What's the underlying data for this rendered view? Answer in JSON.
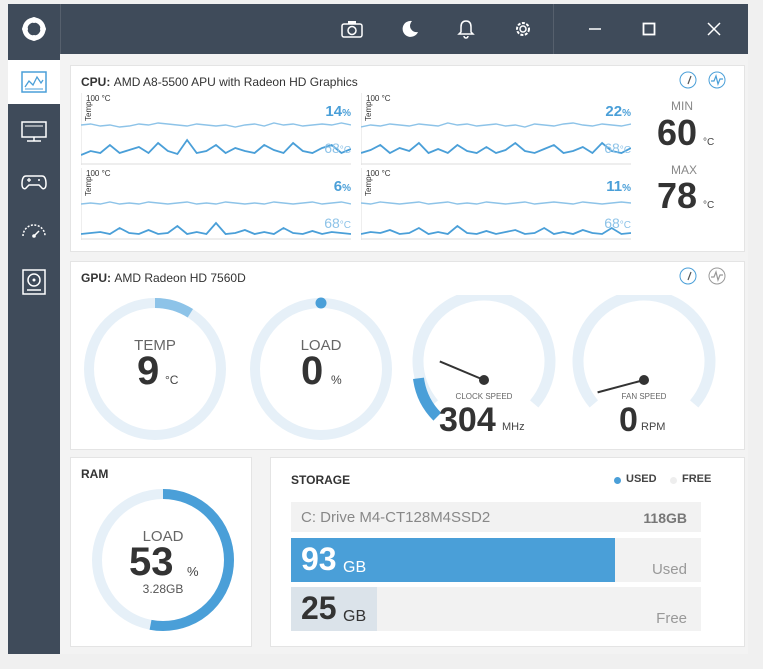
{
  "titlebar": {
    "camera_icon": "camera-icon",
    "moon_icon": "moon-icon",
    "bell_icon": "bell-icon",
    "gear_icon": "gear-icon",
    "min_icon": "minimize-icon",
    "max_icon": "maximize-icon",
    "close_icon": "close-icon"
  },
  "sidebar": {
    "items": [
      "dashboard-icon",
      "monitor-icon",
      "gamepad-icon",
      "gauge-icon",
      "hdd-icon"
    ]
  },
  "cpu": {
    "label": "CPU:",
    "name": "AMD A8-5500 APU with Radeon HD Graphics",
    "graphs": [
      {
        "top_label": "100 °C",
        "axis_label": "Temp",
        "load": "14",
        "temp": "68"
      },
      {
        "top_label": "100 °C",
        "axis_label": "Temp",
        "load": "22",
        "temp": "68"
      },
      {
        "top_label": "100 °C",
        "axis_label": "Temp",
        "load": "6",
        "temp": "68"
      },
      {
        "top_label": "100 °C",
        "axis_label": "Temp",
        "load": "11",
        "temp": "68"
      }
    ],
    "pct_unit": "%",
    "temp_unit": "°C",
    "min_label": "MIN",
    "min_value": "60",
    "max_label": "MAX",
    "max_value": "78",
    "mm_unit": "°C"
  },
  "gpu": {
    "label": "GPU:",
    "name": "AMD Radeon HD 7560D",
    "temp": {
      "label": "TEMP",
      "value": "9",
      "unit": "°C",
      "fraction": 0.09
    },
    "load": {
      "label": "LOAD",
      "value": "0",
      "unit": "%",
      "fraction": 0.0
    },
    "clock": {
      "label": "CLOCK SPEED",
      "value": "304",
      "unit": "MHz",
      "fraction": 0.14
    },
    "fan": {
      "label": "FAN SPEED",
      "value": "0",
      "unit": "RPM",
      "fraction": 0.0
    }
  },
  "ram": {
    "title": "RAM",
    "label": "LOAD",
    "value": "53",
    "unit": "%",
    "used": "3.28GB",
    "fraction": 0.53
  },
  "storage": {
    "title": "STORAGE",
    "legend_used": "USED",
    "legend_free": "FREE",
    "drive": "C: Drive M4-CT128M4SSD2",
    "total": "118GB",
    "used_value": "93",
    "used_unit": "GB",
    "used_label": "Used",
    "used_fraction": 0.79,
    "free_value": "25",
    "free_unit": "GB",
    "free_label": "Free",
    "free_fraction": 0.21
  },
  "colors": {
    "accent": "#4a9fd8",
    "light": "#8dc3e8",
    "track": "#e6f0f8",
    "titlebar": "#3f4b5a"
  }
}
